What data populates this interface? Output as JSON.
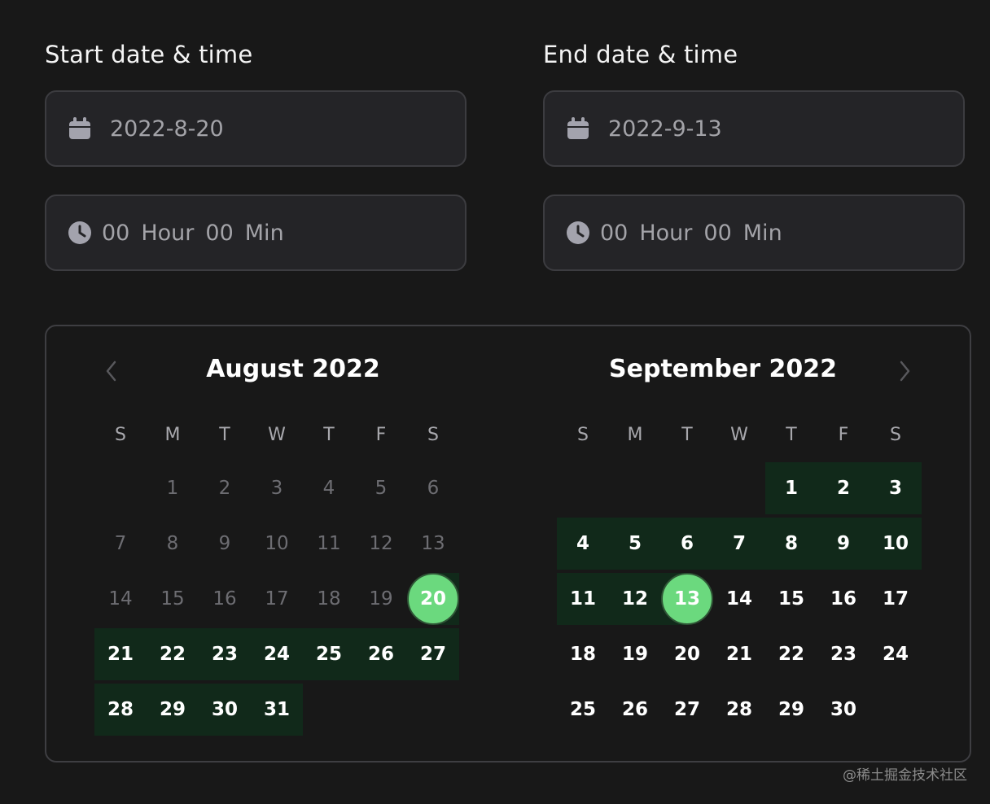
{
  "start": {
    "title": "Start date & time",
    "date": "2022-8-20",
    "hour_value": "00",
    "hour_label": "Hour",
    "min_value": "00",
    "min_label": "Min"
  },
  "end": {
    "title": "End date & time",
    "date": "2022-9-13",
    "hour_value": "00",
    "hour_label": "Hour",
    "min_value": "00",
    "min_label": "Min"
  },
  "weekdays": [
    "S",
    "M",
    "T",
    "W",
    "T",
    "F",
    "S"
  ],
  "calendars": [
    {
      "title": "August 2022",
      "first_weekday": 1,
      "days_in_month": 31,
      "range_from": 21,
      "range_to": 31,
      "selected_day": 20
    },
    {
      "title": "September 2022",
      "first_weekday": 4,
      "days_in_month": 30,
      "range_from": 1,
      "range_to": 12,
      "selected_day": 13
    }
  ],
  "colors": {
    "accent": "#6bd97e",
    "range": "#11291a",
    "background": "#181818",
    "field": "#242427"
  },
  "icons": {
    "date": "calendar-icon",
    "time": "clock-icon",
    "prev": "chevron-left-icon",
    "next": "chevron-right-icon"
  },
  "watermark": "@稀土掘金技术社区"
}
